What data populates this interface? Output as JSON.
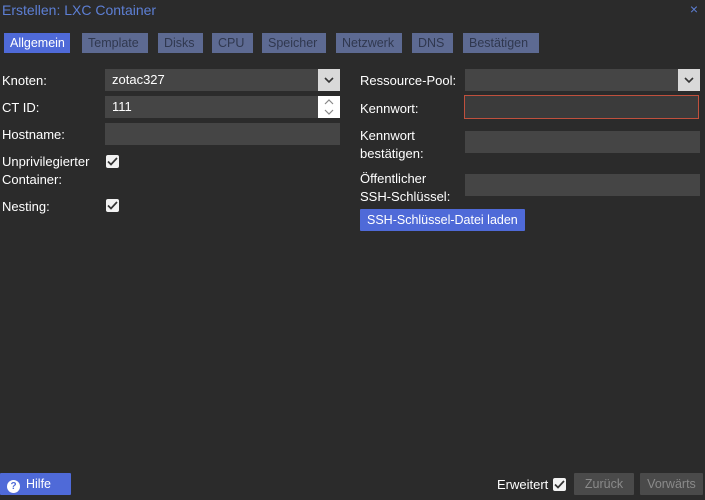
{
  "window": {
    "title": "Erstellen: LXC Container",
    "close_glyph": "×"
  },
  "tabs": [
    {
      "label": "Allgemein",
      "active": true
    },
    {
      "label": "Template",
      "active": false
    },
    {
      "label": "Disks",
      "active": false
    },
    {
      "label": "CPU",
      "active": false
    },
    {
      "label": "Speicher",
      "active": false
    },
    {
      "label": "Netzwerk",
      "active": false
    },
    {
      "label": "DNS",
      "active": false
    },
    {
      "label": "Bestätigen",
      "active": false
    }
  ],
  "left": {
    "node_label": "Knoten:",
    "node_value": "zotac327",
    "ctid_label": "CT ID:",
    "ctid_value": "111",
    "hostname_label": "Hostname:",
    "hostname_value": "",
    "unpriv_label_1": "Unprivilegierter",
    "unpriv_label_2": "Container:",
    "unpriv_checked": true,
    "nesting_label": "Nesting:",
    "nesting_checked": true
  },
  "right": {
    "pool_label": "Ressource-Pool:",
    "pool_value": "",
    "password_label": "Kennwort:",
    "password_value": "",
    "confirm_label_1": "Kennwort",
    "confirm_label_2": "bestätigen:",
    "ssh_label_1": "Öffentlicher",
    "ssh_label_2": "SSH-Schlüssel:",
    "ssh_button": "SSH-Schlüssel-Datei laden"
  },
  "footer": {
    "help": "Hilfe",
    "advanced_label": "Erweitert",
    "advanced_checked": true,
    "back": "Zurück",
    "next": "Vorwärts"
  },
  "colors": {
    "accent": "#4f6ad8",
    "title": "#5d7fd4",
    "background": "#2b2b2b",
    "field": "#454545",
    "invalid_border": "#c0503d"
  }
}
